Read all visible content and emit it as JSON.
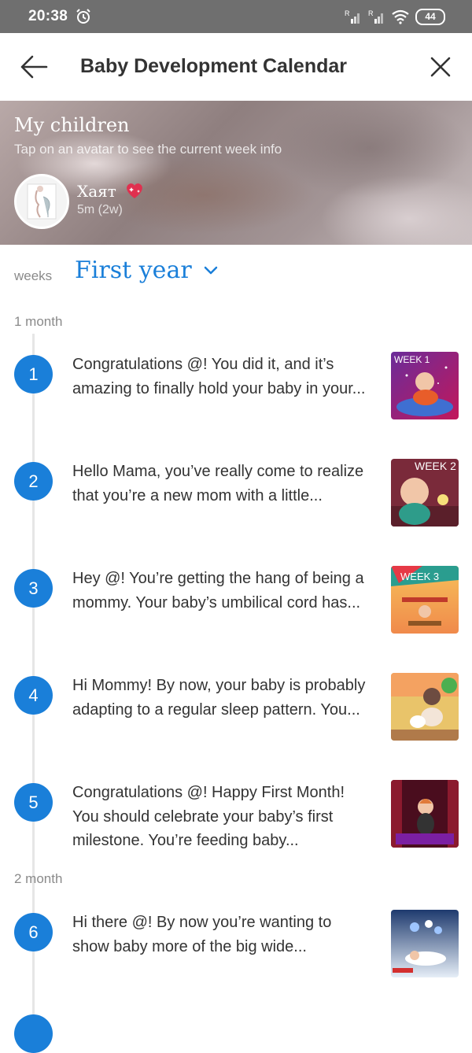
{
  "status_bar": {
    "time": "20:38",
    "battery": "44"
  },
  "header": {
    "title": "Baby Development Calendar"
  },
  "children": {
    "title": "My children",
    "subtitle": "Tap on an avatar to see the current week info",
    "child": {
      "name": "Хаят",
      "age": "5m (2w)"
    }
  },
  "selector": {
    "label": "weeks",
    "value": "First year"
  },
  "months": [
    "1 month",
    "2 month"
  ],
  "weeks": [
    {
      "number": "1",
      "text": "Congratulations @! You did it, and it’s amazing to finally hold your baby in your...",
      "thumb_label": "WEEK 1"
    },
    {
      "number": "2",
      "text": "Hello Mama, you’ve really come to realize that you’re a new mom with a little...",
      "thumb_label": "WEEK 2"
    },
    {
      "number": "3",
      "text": "Hey @! You’re getting the hang of being a mommy. Your baby’s umbilical cord has...",
      "thumb_label": "WEEK 3"
    },
    {
      "number": "4",
      "text": "Hi Mommy! By now, your baby is probably adapting to a regular sleep pattern. You...",
      "thumb_label": ""
    },
    {
      "number": "5",
      "text": "Congratulations @! Happy First Month! You should celebrate your baby’s first milestone. You’re feeding baby...",
      "thumb_label": ""
    },
    {
      "number": "6",
      "text": "Hi there @! By now you’re wanting to show baby more of the big wide...",
      "thumb_label": ""
    }
  ],
  "colors": {
    "accent": "#1a7fd9",
    "status_bar": "#6f6f6f",
    "text": "#333333",
    "muted": "#8a8a8a"
  }
}
